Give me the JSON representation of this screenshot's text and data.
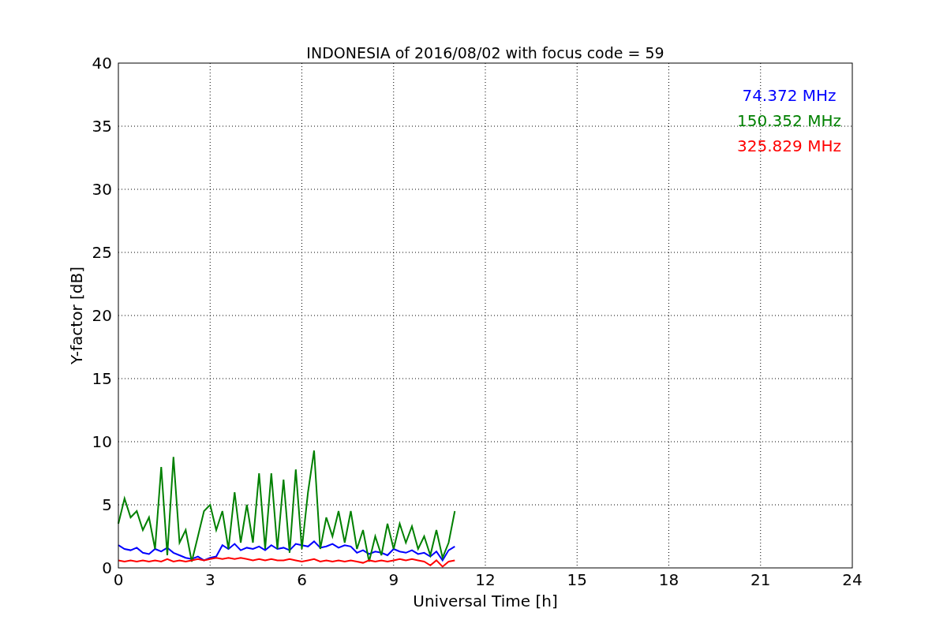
{
  "figure": {
    "chart_data": {
      "type": "line",
      "grid": true,
      "title": "INDONESIA of 2016/08/02 with focus code = 59",
      "xlabel": "Universal Time [h]",
      "ylabel": "Y-factor [dB]",
      "xlim": [
        0,
        24
      ],
      "ylim": [
        0,
        40
      ],
      "xticks": [
        0,
        3,
        6,
        9,
        12,
        15,
        18,
        21,
        24
      ],
      "yticks": [
        0,
        5,
        10,
        15,
        20,
        25,
        30,
        35,
        40
      ],
      "x": [
        0,
        0.2,
        0.4,
        0.6,
        0.8,
        1.0,
        1.2,
        1.4,
        1.6,
        1.8,
        2.0,
        2.2,
        2.4,
        2.6,
        2.8,
        3.0,
        3.2,
        3.4,
        3.6,
        3.8,
        4.0,
        4.2,
        4.4,
        4.6,
        4.8,
        5.0,
        5.2,
        5.4,
        5.6,
        5.8,
        6.0,
        6.2,
        6.4,
        6.6,
        6.8,
        7.0,
        7.2,
        7.4,
        7.6,
        7.8,
        8.0,
        8.2,
        8.4,
        8.6,
        8.8,
        9.0,
        9.2,
        9.4,
        9.6,
        9.8,
        10.0,
        10.2,
        10.4,
        10.6,
        10.8,
        11.0
      ],
      "series": [
        {
          "name": "74.372 MHz",
          "color": "#0000ff",
          "values": [
            1.8,
            1.5,
            1.4,
            1.6,
            1.2,
            1.1,
            1.5,
            1.3,
            1.6,
            1.2,
            1.0,
            0.8,
            0.7,
            0.9,
            0.6,
            0.8,
            0.9,
            1.8,
            1.5,
            1.9,
            1.4,
            1.6,
            1.5,
            1.7,
            1.4,
            1.8,
            1.5,
            1.6,
            1.4,
            1.9,
            1.8,
            1.7,
            2.1,
            1.6,
            1.7,
            1.9,
            1.6,
            1.8,
            1.7,
            1.2,
            1.4,
            1.1,
            1.3,
            1.2,
            1.0,
            1.5,
            1.3,
            1.2,
            1.4,
            1.1,
            1.2,
            0.9,
            1.3,
            0.6,
            1.4,
            1.7
          ]
        },
        {
          "name": "150.352 MHz",
          "color": "#008000",
          "values": [
            3.5,
            5.5,
            4.0,
            4.5,
            3.0,
            4.0,
            1.5,
            8.0,
            1.0,
            8.8,
            2.0,
            3.0,
            0.5,
            2.5,
            4.5,
            5.0,
            3.0,
            4.5,
            1.5,
            6.0,
            2.0,
            5.0,
            2.0,
            7.5,
            1.5,
            7.5,
            1.5,
            7.0,
            1.2,
            7.8,
            1.5,
            6.0,
            9.3,
            1.5,
            4.0,
            2.5,
            4.5,
            2.0,
            4.5,
            1.5,
            3.0,
            0.5,
            2.5,
            1.0,
            3.5,
            1.5,
            3.5,
            2.0,
            3.3,
            1.5,
            2.5,
            1.0,
            3.0,
            0.8,
            2.0,
            4.5
          ]
        },
        {
          "name": "325.829 MHz",
          "color": "#ff0000",
          "values": [
            0.6,
            0.5,
            0.6,
            0.5,
            0.6,
            0.5,
            0.6,
            0.5,
            0.7,
            0.5,
            0.6,
            0.5,
            0.6,
            0.7,
            0.6,
            0.7,
            0.8,
            0.7,
            0.8,
            0.7,
            0.8,
            0.7,
            0.6,
            0.7,
            0.6,
            0.7,
            0.6,
            0.6,
            0.7,
            0.6,
            0.5,
            0.6,
            0.7,
            0.5,
            0.6,
            0.5,
            0.6,
            0.5,
            0.6,
            0.5,
            0.4,
            0.6,
            0.5,
            0.6,
            0.5,
            0.6,
            0.7,
            0.6,
            0.7,
            0.6,
            0.5,
            0.2,
            0.6,
            0.1,
            0.5,
            0.6
          ]
        }
      ]
    }
  }
}
